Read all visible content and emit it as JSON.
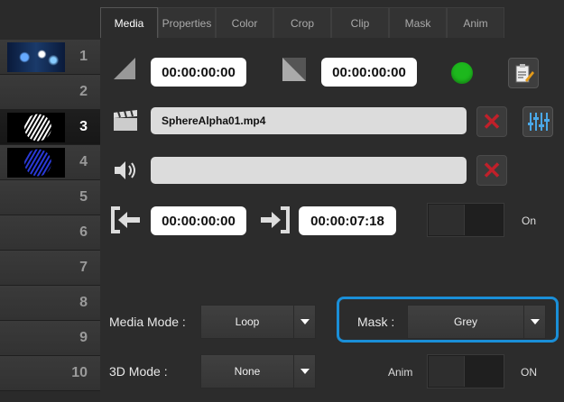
{
  "tabs": [
    "Media",
    "Properties",
    "Color",
    "Crop",
    "Clip",
    "Mask",
    "Anim"
  ],
  "active_tab": "Media",
  "sidebar": {
    "slots": [
      {
        "number": "1",
        "has_thumb": true,
        "thumb": "fireworks"
      },
      {
        "number": "2"
      },
      {
        "number": "3",
        "active": true,
        "thumb": "white-sphere"
      },
      {
        "number": "4",
        "thumb": "blue-sphere"
      },
      {
        "number": "5"
      },
      {
        "number": "6"
      },
      {
        "number": "7"
      },
      {
        "number": "8"
      },
      {
        "number": "9"
      },
      {
        "number": "10"
      }
    ]
  },
  "media": {
    "in_time": "00:00:00:00",
    "out_time": "00:00:00:00",
    "filename": "SphereAlpha01.mp4",
    "audio_file": "",
    "trim_in": "00:00:00:00",
    "trim_out": "00:00:07:18",
    "loop_toggle_label": "On",
    "status_color": "#1db81d"
  },
  "controls": {
    "media_mode_label": "Media Mode :",
    "media_mode_value": "Loop",
    "mask_label": "Mask :",
    "mask_value": "Grey",
    "mode_3d_label": "3D Mode :",
    "mode_3d_value": "None",
    "anim_label": "Anim",
    "anim_toggle_label": "ON"
  },
  "colors": {
    "accent": "#1a8fd8",
    "delete": "#c0202a"
  }
}
